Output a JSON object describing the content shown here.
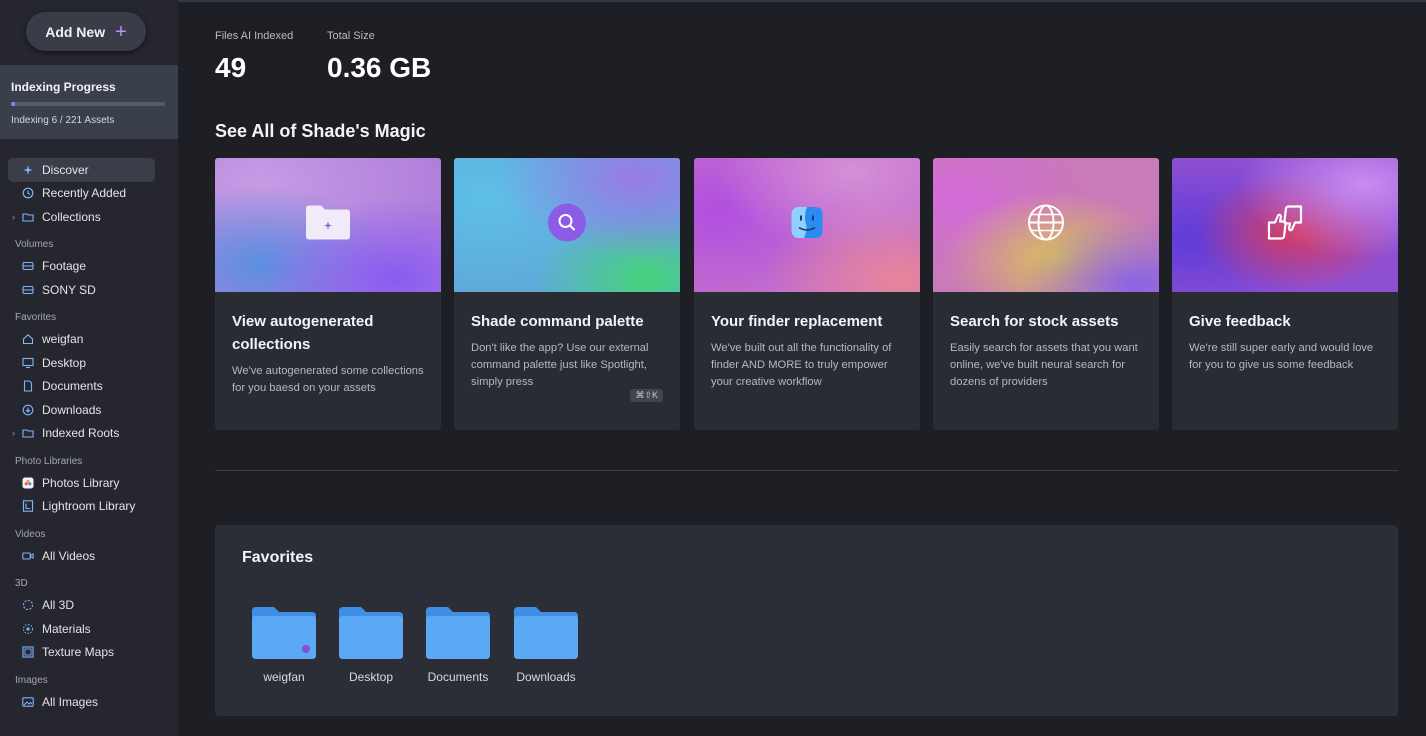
{
  "sidebar": {
    "add_new_label": "Add New",
    "progress": {
      "title": "Indexing Progress",
      "status": "Indexing 6 / 221 Assets",
      "fraction": 0.027
    },
    "items": [
      {
        "label": "Discover",
        "icon": "sparkle-icon"
      },
      {
        "label": "Recently Added",
        "icon": "clock-icon"
      },
      {
        "label": "Collections",
        "icon": "folder-icon"
      }
    ],
    "volumes_label": "Volumes",
    "volumes": [
      {
        "label": "Footage",
        "icon": "drive-icon"
      },
      {
        "label": "SONY SD",
        "icon": "drive-icon"
      }
    ],
    "favorites_label": "Favorites",
    "favorites": [
      {
        "label": "weigfan",
        "icon": "home-icon"
      },
      {
        "label": "Desktop",
        "icon": "desktop-icon"
      },
      {
        "label": "Documents",
        "icon": "document-icon"
      },
      {
        "label": "Downloads",
        "icon": "download-icon"
      },
      {
        "label": "Indexed Roots",
        "icon": "folder-icon"
      }
    ],
    "photo_libraries_label": "Photo Libraries",
    "photo_libraries": [
      {
        "label": "Photos Library",
        "icon": "photos-icon"
      },
      {
        "label": "Lightroom Library",
        "icon": "lightroom-icon"
      }
    ],
    "videos_label": "Videos",
    "videos": [
      {
        "label": "All Videos",
        "icon": "video-icon"
      }
    ],
    "threed_label": "3D",
    "threed": [
      {
        "label": "All 3D",
        "icon": "cube-icon"
      },
      {
        "label": "Materials",
        "icon": "material-icon"
      },
      {
        "label": "Texture Maps",
        "icon": "texture-icon"
      }
    ],
    "images_label": "Images",
    "images": [
      {
        "label": "All Images",
        "icon": "image-icon"
      }
    ]
  },
  "stats": {
    "files_label": "Files AI Indexed",
    "files_value": "49",
    "size_label": "Total Size",
    "size_value": "0.36 GB"
  },
  "magic": {
    "heading": "See All of Shade's Magic",
    "cards": [
      {
        "title": "View autogenerated collections",
        "desc": "We've autogenerated some collections for you baesd on your assets",
        "icon": "sparkle-folder-icon"
      },
      {
        "title": "Shade command palette",
        "desc": "Don't like the app? Use our external command palette just like Spotlight, simply press",
        "shortcut": "⌘⇧K",
        "icon": "search-icon"
      },
      {
        "title": "Your finder replacement",
        "desc": "We've built out all the functionality of finder AND MORE to truly empower your creative workflow",
        "icon": "finder-icon"
      },
      {
        "title": "Search for stock assets",
        "desc": "Easily search for assets that you want online, we've built neural search for dozens of providers",
        "icon": "globe-icon"
      },
      {
        "title": "Give feedback",
        "desc": "We're still super early and would love for you to give us some feedback",
        "icon": "feedback-icon"
      }
    ]
  },
  "favorites_panel": {
    "title": "Favorites",
    "items": [
      "weigfan",
      "Desktop",
      "Documents",
      "Downloads"
    ]
  },
  "colors": {
    "accent": "#9b7bff",
    "folder_blue": "#4b9cf0",
    "sidebar_bg": "#26272e",
    "main_bg": "#1e1f25"
  }
}
